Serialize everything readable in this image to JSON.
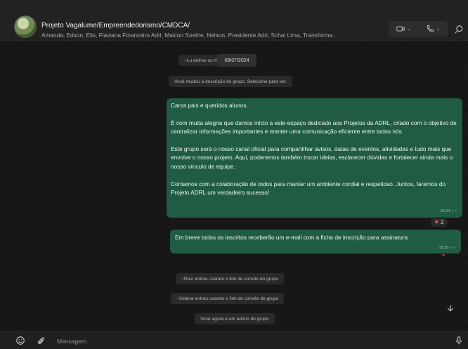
{
  "header": {
    "title": "Projeto Vagalume/Empreendedorismo/CMDCA/",
    "members": "Amanda, Edson, Elis, Flaviana Financeiro Adrl, Maicon Soethe, Nelson, Presidente Adri, Schai Lima, Transforma...",
    "video_icon": "video-camera-icon",
    "call_icon": "phone-icon",
    "search_icon": "search-icon"
  },
  "chat": {
    "date": "09/07/2024",
    "system_messages": [
      "~Lu entrou us             meio do grupo",
      "Você mudou a descrição do grupo. Selecione para ver.",
      "~Rosi entrou usando o link de convite do grupo",
      "~Selena    entrou usando o link de convite do grupo",
      "Você agora é um admin do grupo"
    ],
    "message1": {
      "paragraphs": [
        "Caros pais e queridos alunos.",
        "É com muita alegria que damos início a este espaço dedicado aos Projetos da ADRL, criado com o objetivo de centralizar informações importantes e manter uma comunicação eficiente entre todos nós.",
        "Este grupo será o nosso canal oficial para compartilhar avisos, datas de eventos, atividades e tudo mais que envolve o nosso projeto. Aqui, poderemos também trocar ideias, esclarecer dúvidas e fortalecer ainda mais o nosso vínculo de equipe.",
        "Contamos com a colaboração de todos para manter um ambiente cordial e respeitoso. Juntos, faremos do Projeto ADRL um verdadeiro sucesso!"
      ],
      "time": "18:24 ✓✓",
      "reaction_emoji": "♥",
      "reaction_count": "2"
    },
    "message2": {
      "text": "Em breve todos os inscritos receberão um e-mail com a ficha de inscrição para assinatura",
      "time": "18:25 ✓✓"
    }
  },
  "footer": {
    "placeholder": "Mensagem",
    "emoji_icon": "emoji-icon",
    "attach_icon": "paperclip-icon",
    "mic_icon": "microphone-icon"
  },
  "colors": {
    "outgoing_bubble": "#1f5c43",
    "background": "#171717",
    "header": "#222222"
  }
}
